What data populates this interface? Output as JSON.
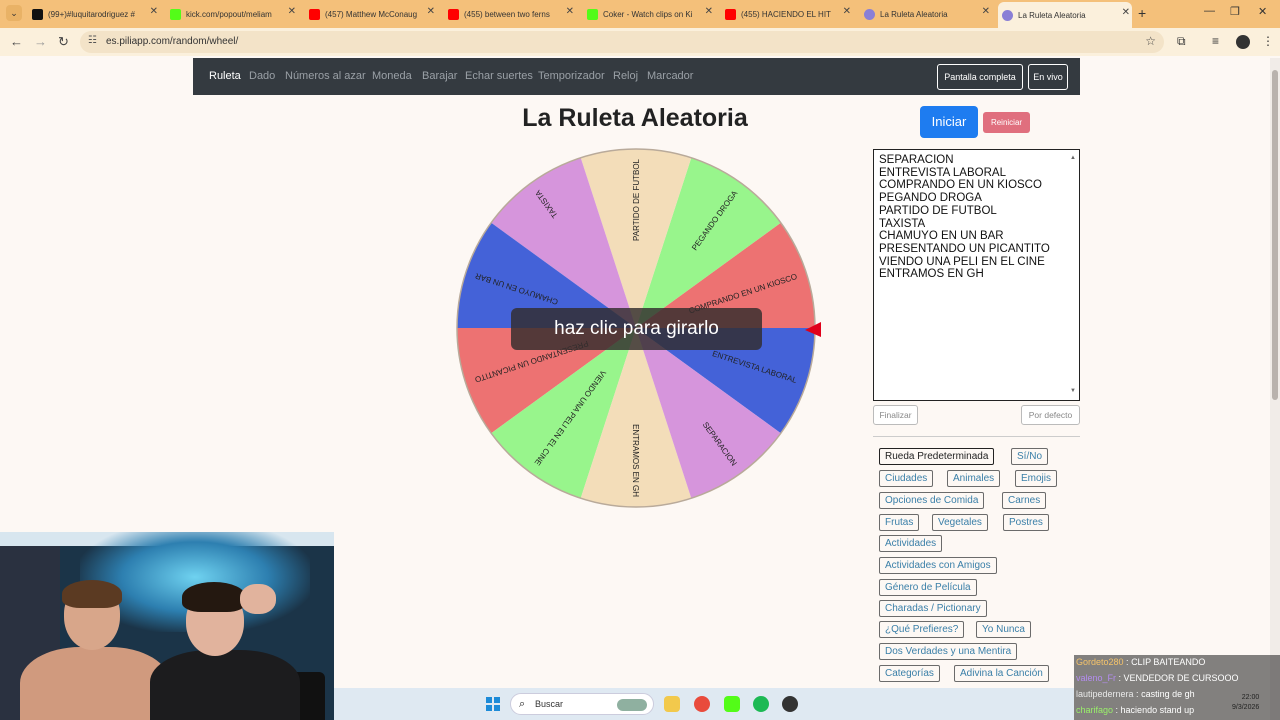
{
  "browser": {
    "tabs": [
      {
        "title": "(99+)#luquitarodriguez #",
        "color": "#111111"
      },
      {
        "title": "kick.com/popout/meliam",
        "color": "#53fc18"
      },
      {
        "title": "(457) Matthew McConaug",
        "color": "#ff0000"
      },
      {
        "title": "(455) between two ferns",
        "color": "#ff0000"
      },
      {
        "title": "Coker - Watch clips on Ki",
        "color": "#53fc18"
      },
      {
        "title": "(455) HACIENDO EL HIT",
        "color": "#ff0000"
      },
      {
        "title": "La Ruleta Aleatoria",
        "color": "#8a7fd6"
      },
      {
        "title": "La Ruleta Aleatoria",
        "color": "#8a7fd6"
      }
    ],
    "url": "es.piliapp.com/random/wheel/"
  },
  "site_nav": {
    "links": [
      "Ruleta",
      "Dado",
      "Números al azar",
      "Moneda",
      "Barajar",
      "Echar suertes",
      "Temporizador",
      "Reloj",
      "Marcador"
    ],
    "fullscreen_label": "Pantalla completa",
    "live_label": "En vivo"
  },
  "page": {
    "title": "La Ruleta Aleatoria",
    "spin_hint": "haz clic para girarlo",
    "start_label": "Iniciar",
    "reset_label": "Reiniciar",
    "finish_label": "Finalizar",
    "default_label": "Por defecto"
  },
  "wheel": {
    "segments": [
      {
        "label": "SEPARACION",
        "color": "#4462d8"
      },
      {
        "label": "ENTREVISTA LABORAL",
        "color": "#ed7272"
      },
      {
        "label": "COMPRANDO EN UN KIOSCO",
        "color": "#98f58c"
      },
      {
        "label": "PEGANDO DROGA",
        "color": "#f3ddb9"
      },
      {
        "label": "PARTIDO DE FUTBOL",
        "color": "#d695dc"
      },
      {
        "label": "TAXISTA",
        "color": "#4462d8"
      },
      {
        "label": "CHAMUYO EN UN BAR",
        "color": "#ed7272"
      },
      {
        "label": "PRESENTANDO UN PICANTITO",
        "color": "#98f58c"
      },
      {
        "label": "VIENDO UNA PELI EN EL CINE",
        "color": "#f3ddb9"
      },
      {
        "label": "ENTRAMOS EN GH",
        "color": "#d695dc"
      }
    ],
    "pointer_color": "#e0001a"
  },
  "entries_text": [
    "SEPARACION",
    "ENTREVISTA LABORAL",
    "COMPRANDO EN UN KIOSCO",
    "PEGANDO DROGA",
    "PARTIDO DE FUTBOL",
    "TAXISTA",
    "CHAMUYO EN UN BAR",
    "PRESENTANDO UN PICANTITO",
    "VIENDO UNA PELI EN EL CINE",
    "ENTRAMOS EN GH"
  ],
  "presets": [
    "Rueda Predeterminada",
    "Sí/No",
    "Ciudades",
    "Animales",
    "Emojis",
    "Opciones de Comida",
    "Carnes",
    "Frutas",
    "Vegetales",
    "Postres",
    "Actividades",
    "Actividades con Amigos",
    "Género de Película",
    "Charadas / Pictionary",
    "¿Qué Prefieres?",
    "Yo Nunca",
    "Dos Verdades y una Mentira",
    "Categorías",
    "Adivina la Canción"
  ],
  "taskbar": {
    "search_label": "Buscar"
  },
  "chat": [
    {
      "user": "Gordeto280",
      "msg": "CLIP BAITEANDO"
    },
    {
      "user": "valeno_Fr",
      "msg": "VENDEDOR DE CURSOOO"
    },
    {
      "user": "lautipedernera",
      "msg": "casting de gh"
    },
    {
      "user": "charifago",
      "msg": "haciendo stand up"
    }
  ],
  "clock": {
    "time": "22:00",
    "date": "9/3/2026"
  }
}
